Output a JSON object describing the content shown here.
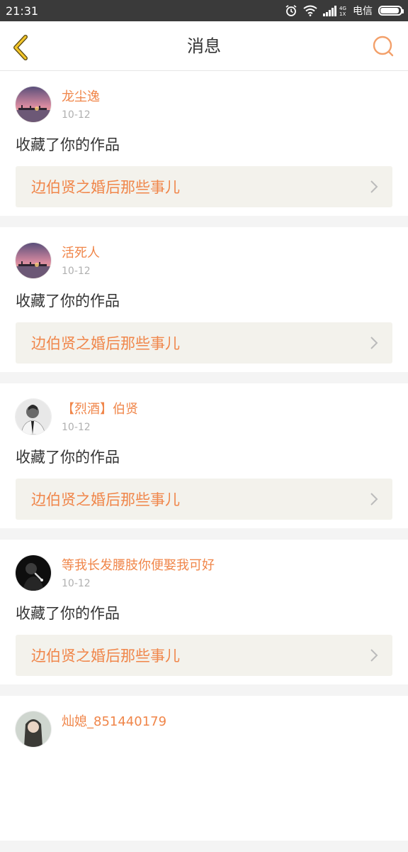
{
  "status_bar": {
    "time": "21:31",
    "carrier": "电信"
  },
  "header": {
    "title": "消息"
  },
  "messages": [
    {
      "username": "龙尘逸",
      "date": "10-12",
      "action": "收藏了你的作品",
      "work_title": "边伯贤之婚后那些事儿"
    },
    {
      "username": "活死人",
      "date": "10-12",
      "action": "收藏了你的作品",
      "work_title": "边伯贤之婚后那些事儿"
    },
    {
      "username": "【烈酒】伯贤",
      "date": "10-12",
      "action": "收藏了你的作品",
      "work_title": "边伯贤之婚后那些事儿"
    },
    {
      "username": "等我长发腰肢你便娶我可好",
      "date": "10-12",
      "action": "收藏了你的作品",
      "work_title": "边伯贤之婚后那些事儿"
    },
    {
      "username": "灿媳_851440179"
    }
  ]
}
